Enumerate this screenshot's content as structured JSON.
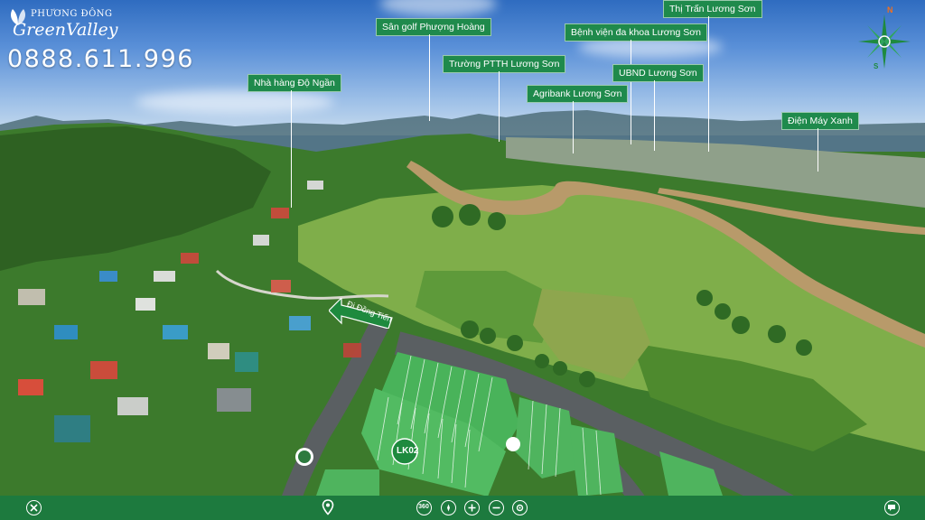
{
  "brand": {
    "logo_top": "PHƯƠNG ĐÔNG",
    "logo_main": "GreenValley",
    "phone": "0888.611.996"
  },
  "pois": [
    {
      "label": "Sân golf Phượng Hoàng"
    },
    {
      "label": "Thị Trấn Lương Sơn"
    },
    {
      "label": "Bệnh viện đa khoa Lương Sơn"
    },
    {
      "label": "Trường PTTH Lương Sơn"
    },
    {
      "label": "UBND Lương Sơn"
    },
    {
      "label": "Nhà hàng Độ Ngần"
    },
    {
      "label": "Agribank Lương Sơn"
    },
    {
      "label": "Điện Máy Xanh"
    }
  ],
  "map_overlay": {
    "road_sign": "Đi Đồng Tiến",
    "lot_label": "LK02"
  },
  "compass": {
    "north": "N",
    "south": "S"
  },
  "toolbar": {
    "close_icon": "close-icon",
    "location_icon": "map-pin-icon",
    "view360_label": "360",
    "gyro_icon": "compass-dial-icon",
    "zoom_in_icon": "plus-icon",
    "zoom_out_icon": "minus-icon",
    "rotate_icon": "rotate-icon",
    "chat_icon": "chat-icon"
  },
  "colors": {
    "toolbar_bg": "#1d7a3e",
    "label_bg": "#1f8a4c",
    "sky": "#2f6cc0"
  }
}
